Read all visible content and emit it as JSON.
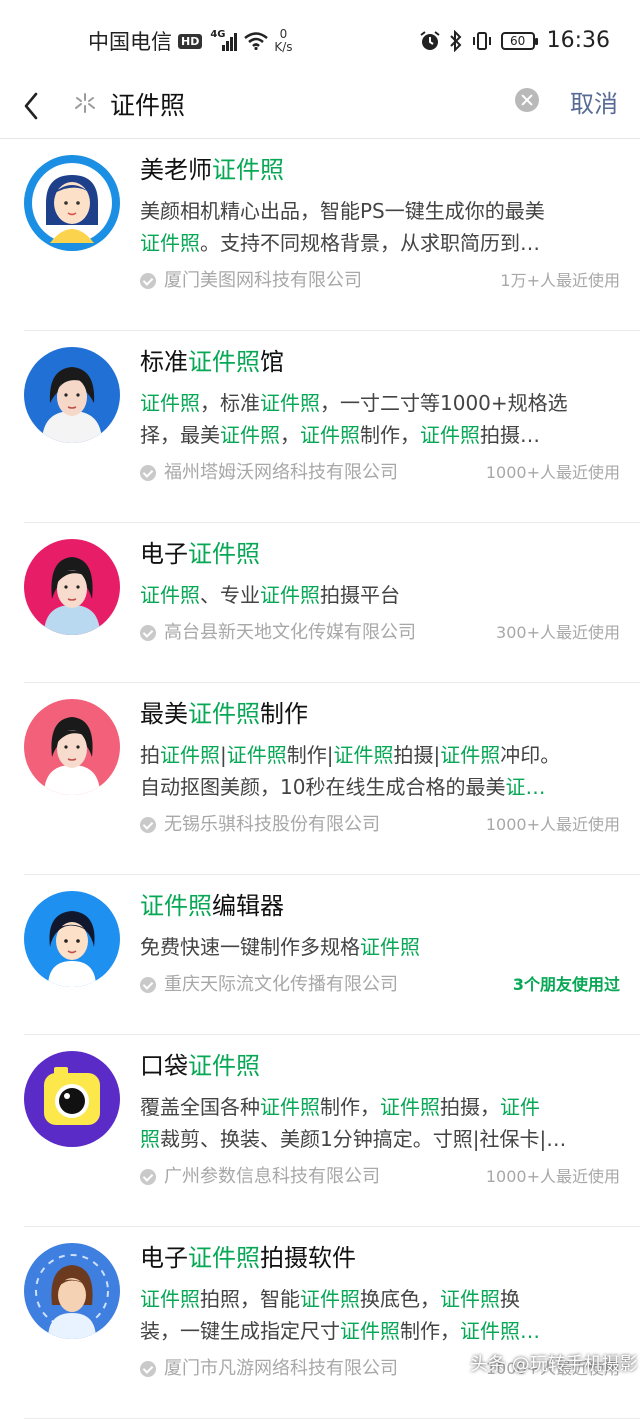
{
  "status_bar": {
    "carrier": "中国电信",
    "hd": "HD",
    "network": "4G",
    "speed_value": "0",
    "speed_unit": "K/s",
    "battery": "60",
    "time": "16:36"
  },
  "search": {
    "query": "证件照",
    "cancel_label": "取消"
  },
  "results": [
    {
      "title": [
        {
          "t": "美老师"
        },
        {
          "t": "证件照",
          "h": true
        }
      ],
      "desc": [
        [
          {
            "t": "美颜相机精心出品，智能PS一键生成你的最美"
          }
        ],
        [
          {
            "t": "证件照",
            "h": true
          },
          {
            "t": "。支持不同规格背景，从求职简历到…"
          }
        ]
      ],
      "company": "厦门美图网科技有限公司",
      "usage": "1万+人最近使用",
      "usage_friend": false
    },
    {
      "title": [
        {
          "t": "标准"
        },
        {
          "t": "证件照",
          "h": true
        },
        {
          "t": "馆"
        }
      ],
      "desc": [
        [
          {
            "t": "证件照",
            "h": true
          },
          {
            "t": "，标准"
          },
          {
            "t": "证件照",
            "h": true
          },
          {
            "t": "，一寸二寸等1000+规格选"
          }
        ],
        [
          {
            "t": "择，最美"
          },
          {
            "t": "证件照",
            "h": true
          },
          {
            "t": "，"
          },
          {
            "t": "证件照",
            "h": true
          },
          {
            "t": "制作，"
          },
          {
            "t": "证件照",
            "h": true
          },
          {
            "t": "拍摄…"
          }
        ]
      ],
      "company": "福州塔姆沃网络科技有限公司",
      "usage": "1000+人最近使用",
      "usage_friend": false
    },
    {
      "title": [
        {
          "t": "电子"
        },
        {
          "t": "证件照",
          "h": true
        }
      ],
      "desc": [
        [
          {
            "t": "证件照",
            "h": true
          },
          {
            "t": "、专业"
          },
          {
            "t": "证件照",
            "h": true
          },
          {
            "t": "拍摄平台"
          }
        ]
      ],
      "company": "高台县新天地文化传媒有限公司",
      "usage": "300+人最近使用",
      "usage_friend": false
    },
    {
      "title": [
        {
          "t": "最美"
        },
        {
          "t": "证件照",
          "h": true
        },
        {
          "t": "制作"
        }
      ],
      "desc": [
        [
          {
            "t": "拍"
          },
          {
            "t": "证件照",
            "h": true
          },
          {
            "t": "|"
          },
          {
            "t": "证件照",
            "h": true
          },
          {
            "t": "制作|"
          },
          {
            "t": "证件照",
            "h": true
          },
          {
            "t": "拍摄|"
          },
          {
            "t": "证件照",
            "h": true
          },
          {
            "t": "冲印。"
          }
        ],
        [
          {
            "t": "自动抠图美颜，10秒在线生成合格的最美"
          },
          {
            "t": "证…",
            "h": true
          }
        ]
      ],
      "company": "无锡乐骐科技股份有限公司",
      "usage": "1000+人最近使用",
      "usage_friend": false
    },
    {
      "title": [
        {
          "t": "证件照",
          "h": true
        },
        {
          "t": "编辑器"
        }
      ],
      "desc": [
        [
          {
            "t": "免费快速一键制作多规格"
          },
          {
            "t": "证件照",
            "h": true
          }
        ]
      ],
      "company": "重庆天际流文化传播有限公司",
      "usage": "3个朋友使用过",
      "usage_friend": true
    },
    {
      "title": [
        {
          "t": "口袋"
        },
        {
          "t": "证件照",
          "h": true
        }
      ],
      "desc": [
        [
          {
            "t": "覆盖全国各种"
          },
          {
            "t": "证件照",
            "h": true
          },
          {
            "t": "制作，"
          },
          {
            "t": "证件照",
            "h": true
          },
          {
            "t": "拍摄，"
          },
          {
            "t": "证件",
            "h": true
          }
        ],
        [
          {
            "t": "照",
            "h": true
          },
          {
            "t": "裁剪、换装、美颜1分钟搞定。寸照|社保卡|…"
          }
        ]
      ],
      "company": "广州参数信息科技有限公司",
      "usage": "1000+人最近使用",
      "usage_friend": false
    },
    {
      "title": [
        {
          "t": "电子"
        },
        {
          "t": "证件照",
          "h": true
        },
        {
          "t": "拍摄软件"
        }
      ],
      "desc": [
        [
          {
            "t": "证件照",
            "h": true
          },
          {
            "t": "拍照，智能"
          },
          {
            "t": "证件照",
            "h": true
          },
          {
            "t": "换底色，"
          },
          {
            "t": "证件照",
            "h": true
          },
          {
            "t": "换"
          }
        ],
        [
          {
            "t": "装，一键生成指定尺寸"
          },
          {
            "t": "证件照",
            "h": true
          },
          {
            "t": "制作，"
          },
          {
            "t": "证件照…",
            "h": true
          }
        ]
      ],
      "company": "厦门市凡游网络科技有限公司",
      "usage": "1000+人最近使用",
      "usage_friend": false
    }
  ],
  "watermark": "头条 @玩转手机摄影",
  "colors": {
    "highlight": "#07a855",
    "cancel": "#576b95"
  }
}
